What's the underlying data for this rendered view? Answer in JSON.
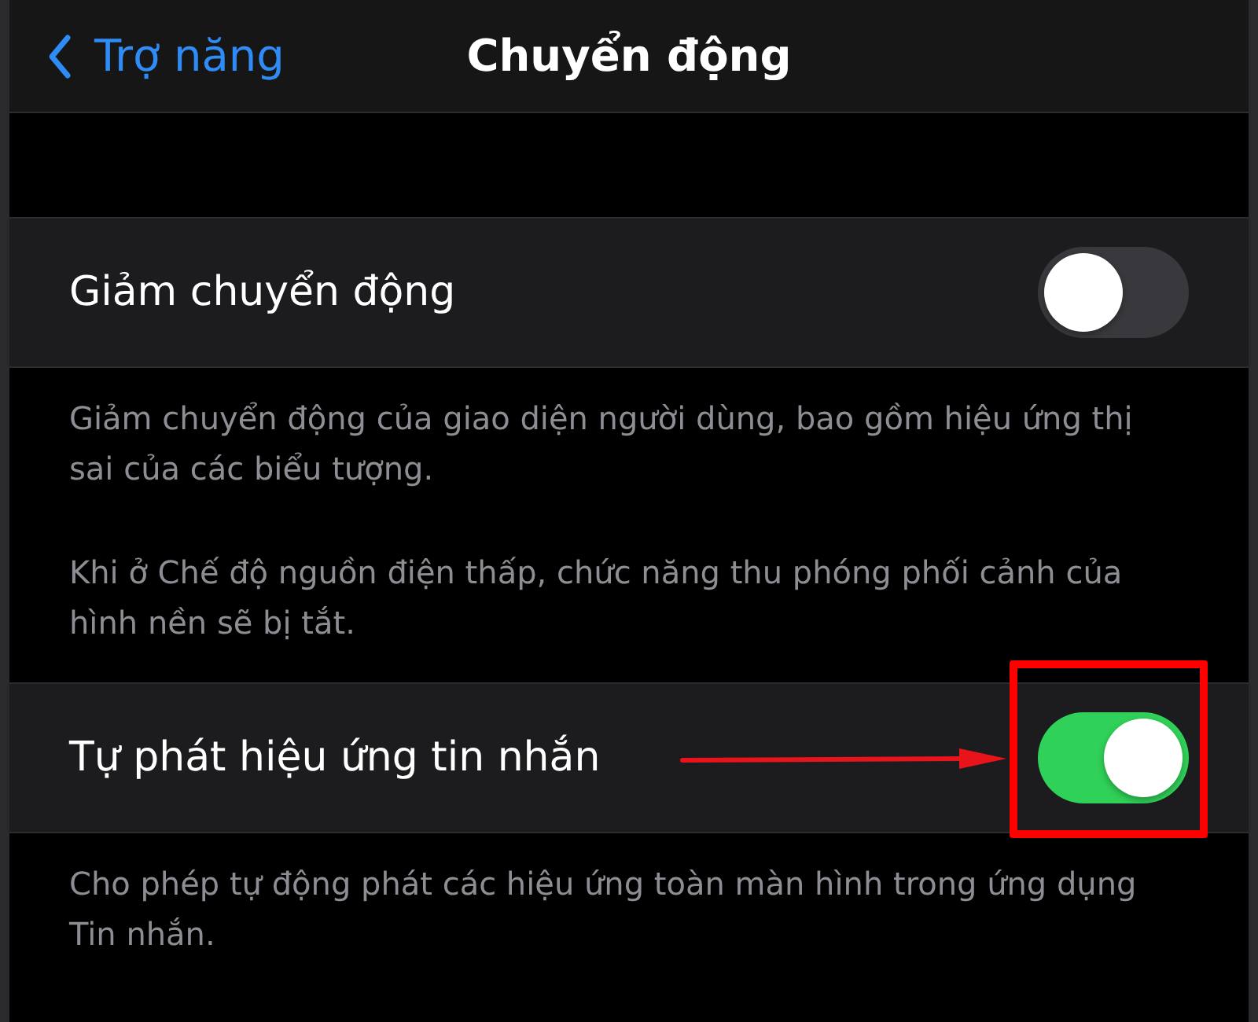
{
  "nav_bar": {
    "back_label": "Trợ năng",
    "title": "Chuyển động"
  },
  "settings": [
    {
      "label": "Giảm chuyển động",
      "on": false,
      "highlighted": false,
      "footer": [
        "Giảm chuyển động của giao diện người dùng, bao gồm hiệu ứng thị sai của các biểu tượng.",
        "Khi ở Chế độ nguồn điện thấp, chức năng thu phóng phối cảnh của hình nền sẽ bị tắt."
      ]
    },
    {
      "label": "Tự phát hiệu ứng tin nhắn",
      "on": true,
      "highlighted": true,
      "footer": [
        "Cho phép tự động phát các hiệu ứng toàn màn hình trong ứng dụng Tin nhắn."
      ]
    }
  ]
}
